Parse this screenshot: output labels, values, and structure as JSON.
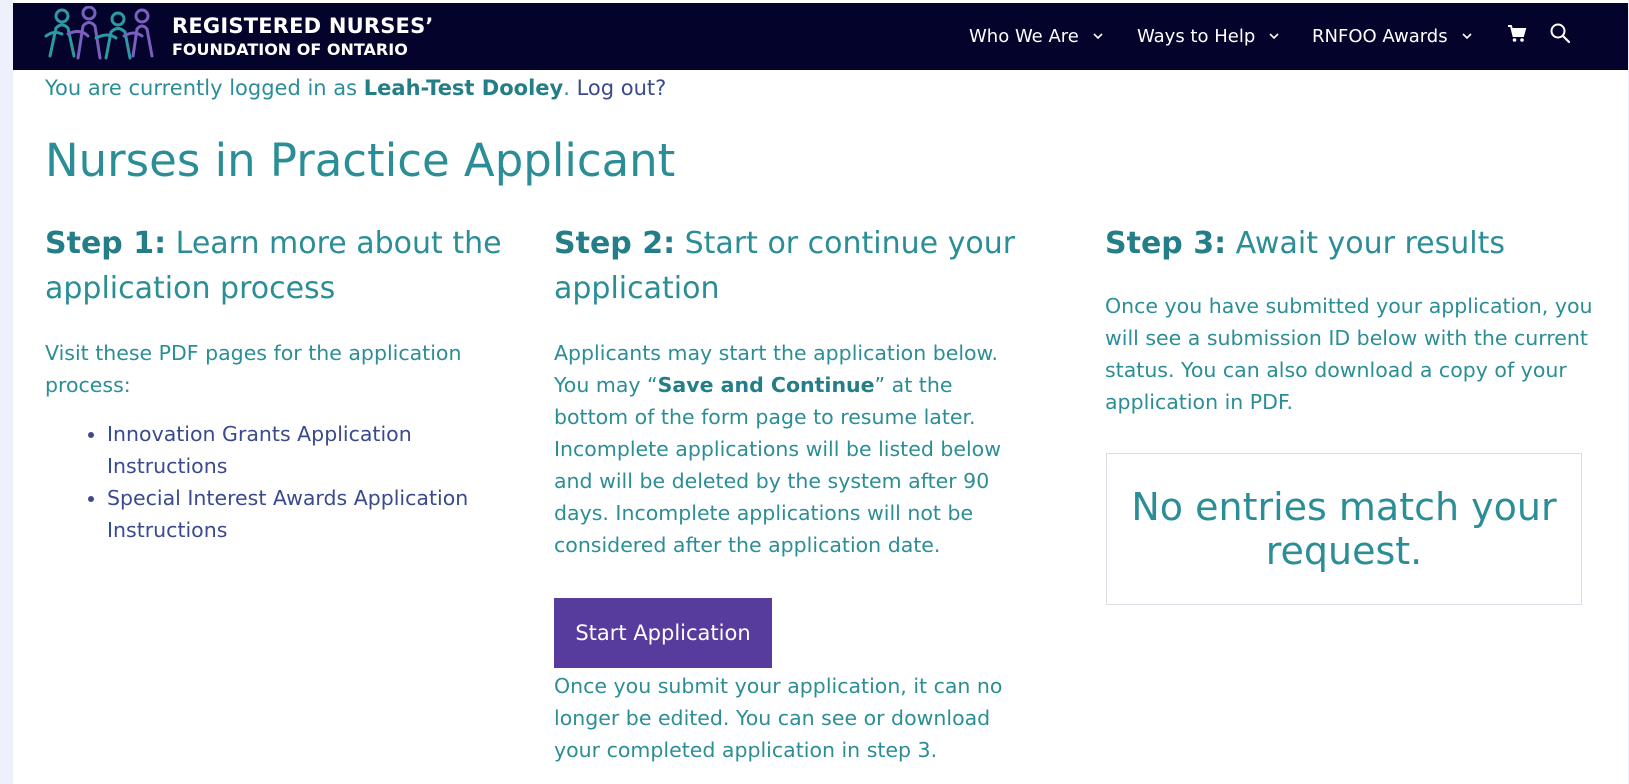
{
  "header": {
    "org_line1": "REGISTERED NURSES’",
    "org_line2": "FOUNDATION OF ONTARIO",
    "nav": [
      {
        "label": "Who We Are",
        "icon": "chevron-down-icon"
      },
      {
        "label": "Ways to Help",
        "icon": "chevron-down-icon"
      },
      {
        "label": "RNFOO Awards",
        "icon": "chevron-down-icon"
      }
    ],
    "icons": [
      "cart-icon",
      "search-icon"
    ],
    "bg_color": "#03032b"
  },
  "login": {
    "prefix": "You are currently logged in as ",
    "user": "Leah-Test Dooley",
    "separator": ". ",
    "logout": "Log out?"
  },
  "page_title": "Nurses in Practice Applicant",
  "step1": {
    "heading_bold": "Step 1:",
    "heading_rest": " Learn more about the application process",
    "intro": "Visit these PDF pages for the application process:",
    "links": [
      "Innovation Grants Application Instructions",
      "Special Interest Awards Application Instructions"
    ]
  },
  "step2": {
    "heading_bold": "Step 2:",
    "heading_rest": " Start or continue your application",
    "text_before": "Applicants may start the application below. You may “",
    "text_bold": "Save and Continue",
    "text_after": "” at the bottom of the form page to resume later. Incomplete applications will be listed below and will be deleted by the system after 90 days. Incomplete applications will not be considered after the application date.",
    "button": "Start Application",
    "note": "Once you submit your application, it can no longer be edited. You can see or download your completed application in step 3."
  },
  "step3": {
    "heading_bold": "Step 3:",
    "heading_rest": " Await your results",
    "text": "Once you have submitted your application, you will see a submission ID below with the current status. You can also download a copy of your application in PDF.",
    "empty_message": "No entries match your request."
  },
  "colors": {
    "teal": "#2b8e96",
    "link": "#3a4a8c",
    "button": "#573c9e"
  }
}
